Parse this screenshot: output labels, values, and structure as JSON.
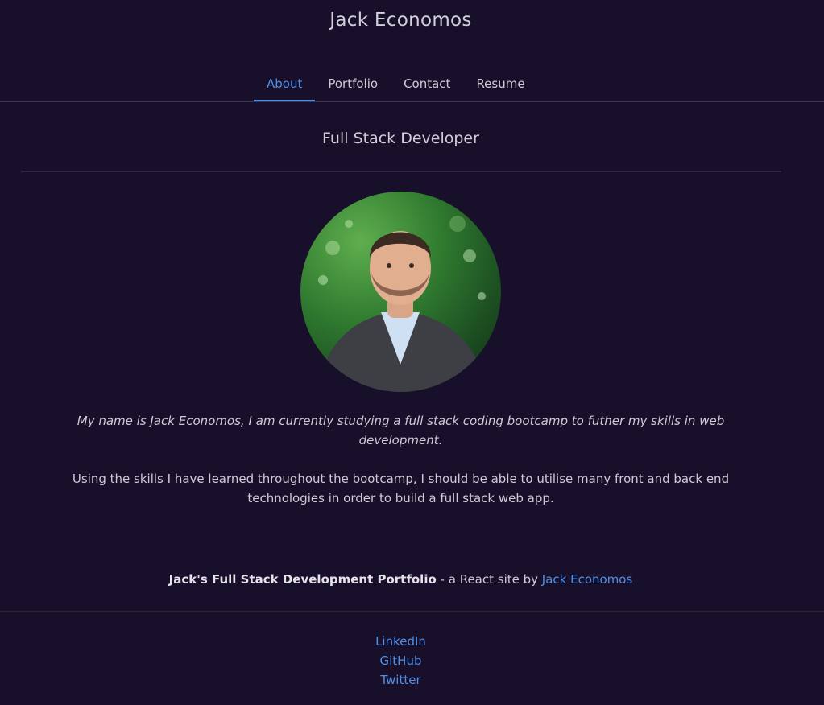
{
  "header": {
    "title": "Jack Economos"
  },
  "nav": {
    "tabs": [
      {
        "label": "About",
        "active": true
      },
      {
        "label": "Portfolio",
        "active": false
      },
      {
        "label": "Contact",
        "active": false
      },
      {
        "label": "Resume",
        "active": false
      }
    ]
  },
  "about": {
    "headline": "Full Stack Developer",
    "photo": {
      "icon": "profile-photo",
      "alt": "Jack Economos"
    },
    "bio": [
      "My name is Jack Economos, I am currently studying a full stack coding bootcamp to futher my skills in web development.",
      "Using the skills I have learned throughout the bootcamp, I should be able to utilise many front and back end technologies in order to build a full stack web app."
    ]
  },
  "footer": {
    "site_name": "Jack's Full Stack Development Portfolio",
    "middle_text": " - a React site by ",
    "author_link": "Jack Economos",
    "social_links": [
      "LinkedIn",
      "GitHub",
      "Twitter"
    ]
  },
  "colors": {
    "background": "#180f2a",
    "accent": "#4f8fe6",
    "text": "#cfcad6"
  }
}
